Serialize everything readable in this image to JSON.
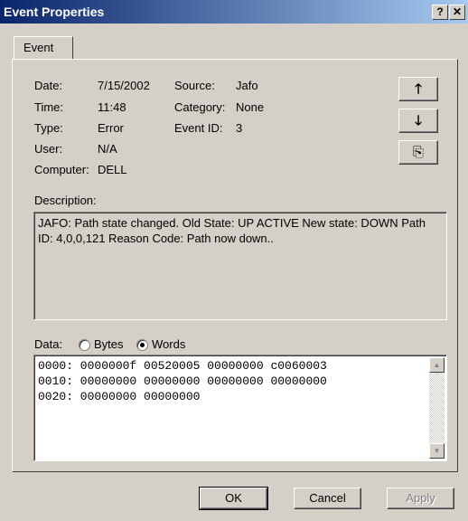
{
  "window": {
    "title": "Event Properties",
    "help_glyph": "?",
    "close_glyph": "✕"
  },
  "tab": {
    "label": "Event"
  },
  "fields": {
    "date_label": "Date:",
    "date_value": "7/15/2002",
    "time_label": "Time:",
    "time_value": "11:48",
    "type_label": "Type:",
    "type_value": "Error",
    "user_label": "User:",
    "user_value": "N/A",
    "computer_label": "Computer:",
    "computer_value": "DELL",
    "source_label": "Source:",
    "source_value": "Jafo",
    "category_label": "Category:",
    "category_value": "None",
    "eventid_label": "Event ID:",
    "eventid_value": "3"
  },
  "nav": {
    "up_glyph": "🡑",
    "down_glyph": "🡓",
    "copy_glyph": "⎘"
  },
  "description": {
    "label": "Description:",
    "text": "JAFO: Path state changed.  Old State: UP ACTIVE  New state: DOWN Path ID: 4,0,0,121  Reason Code: Path now down.."
  },
  "data": {
    "label": "Data:",
    "bytes_label": "Bytes",
    "words_label": "Words",
    "selected": "Words",
    "lines": [
      "0000: 0000000f 00520005 00000000 c0060003",
      "0010: 00000000 00000000 00000000 00000000",
      "0020: 00000000 00000000"
    ]
  },
  "buttons": {
    "ok": "OK",
    "cancel": "Cancel",
    "apply": "Apply"
  },
  "colors": {
    "titlebar_start": "#0a246a",
    "titlebar_end": "#a6caf0",
    "face": "#d4d0c8"
  }
}
